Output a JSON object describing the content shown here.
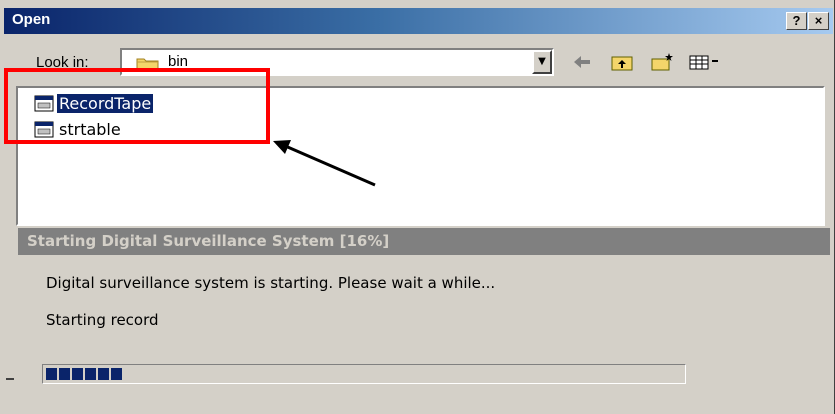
{
  "open_dialog": {
    "title": "Open",
    "help_button": "?",
    "close_button": "×",
    "look_in_label": "Look in:",
    "look_in_value": "bin",
    "toolbar_icons": [
      "back-arrow-icon",
      "up-folder-icon",
      "new-folder-icon",
      "view-menu-icon"
    ],
    "files": [
      {
        "name": "RecordTape",
        "selected": true
      },
      {
        "name": "strtable",
        "selected": false
      }
    ]
  },
  "annotation": {
    "highlight_color": "#ff0000",
    "arrow_color": "#000000"
  },
  "progress_dialog": {
    "title": "Starting Digital Surveillance System [16%]",
    "message": "Digital surveillance system is starting. Please wait a while...",
    "status": "Starting record",
    "progress_fraction": 0.16,
    "bar_color": "#0a246a"
  },
  "colors": {
    "titlebar_start": "#0a246a",
    "titlebar_end": "#a6caf0",
    "dialog_face": "#d4d0c8",
    "inactive_title": "#808080",
    "selection": "#0a246a"
  }
}
